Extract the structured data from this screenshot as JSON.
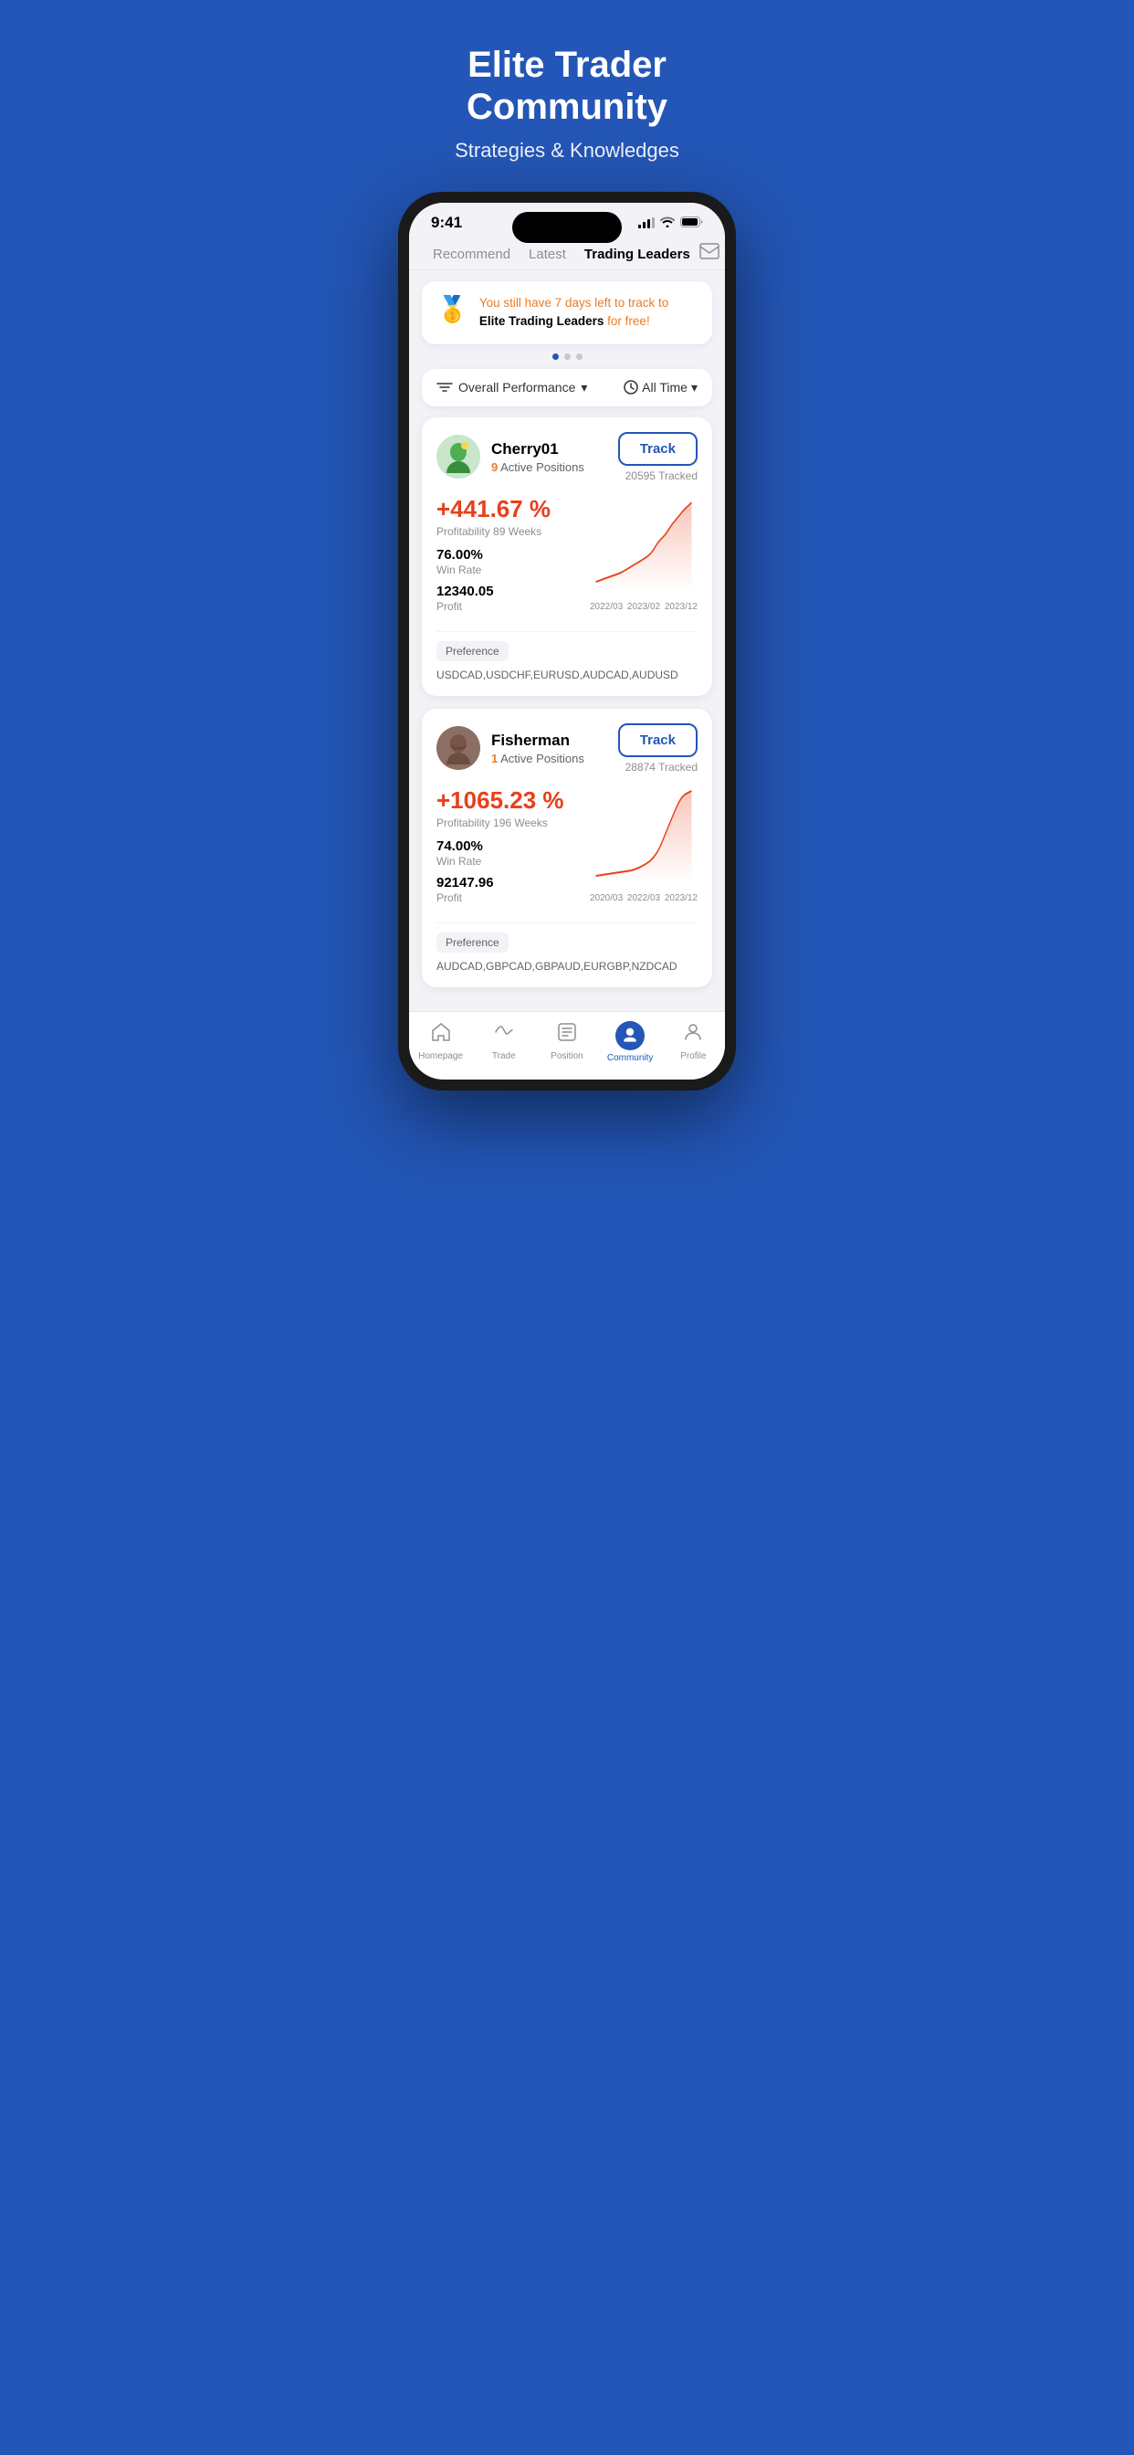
{
  "hero": {
    "title": "Elite Trader\nCommunity",
    "subtitle": "Strategies & Knowledges"
  },
  "statusBar": {
    "time": "9:41"
  },
  "navTabs": {
    "items": [
      {
        "label": "Recommend",
        "active": false
      },
      {
        "label": "Latest",
        "active": false
      },
      {
        "label": "Trading Leaders",
        "active": true
      }
    ]
  },
  "promoBanner": {
    "icon": "🥇",
    "text_highlight": "You still have 7 days left to track to",
    "text_brand": " Elite Trading Leaders",
    "text_end": " for free!"
  },
  "filterBar": {
    "performance_label": "Overall Performance",
    "time_label": "All Time"
  },
  "traders": [
    {
      "name": "Cherry01",
      "active_positions": 9,
      "track_label": "Track",
      "tracked_count": "20595 Tracked",
      "profit_pct": "+441.67 %",
      "profitability_weeks": "Profitability 89 Weeks",
      "win_rate": "76.00%",
      "win_rate_label": "Win Rate",
      "profit": "12340.05",
      "profit_label": "Profit",
      "chart_labels": [
        "2022/03",
        "2023/02",
        "2023/12"
      ],
      "preference_label": "Preference",
      "pairs": "USDCAD,USDCHF,EURUSD,AUDCAD,AUDUSD",
      "avatar_emoji": "🧑",
      "avatar_color": "#c8e6c9"
    },
    {
      "name": "Fisherman",
      "active_positions": 1,
      "track_label": "Track",
      "tracked_count": "28874 Tracked",
      "profit_pct": "+1065.23 %",
      "profitability_weeks": "Profitability 196 Weeks",
      "win_rate": "74.00%",
      "win_rate_label": "Win Rate",
      "profit": "92147.96",
      "profit_label": "Profit",
      "chart_labels": [
        "2020/03",
        "2022/03",
        "2023/12"
      ],
      "preference_label": "Preference",
      "pairs": "AUDCAD,GBPCAD,GBPAUD,EURGBP,NZDCAD",
      "avatar_emoji": "🧔",
      "avatar_color": "#8d6e63"
    }
  ],
  "bottomNav": {
    "items": [
      {
        "label": "Homepage",
        "icon": "home",
        "active": false
      },
      {
        "label": "Trade",
        "icon": "trade",
        "active": false
      },
      {
        "label": "Position",
        "icon": "position",
        "active": false
      },
      {
        "label": "Community",
        "icon": "community",
        "active": true
      },
      {
        "label": "Profile",
        "icon": "profile",
        "active": false
      }
    ]
  },
  "colors": {
    "brand": "#2356b6",
    "profit": "#e8401a",
    "warning": "#e87d2a"
  }
}
